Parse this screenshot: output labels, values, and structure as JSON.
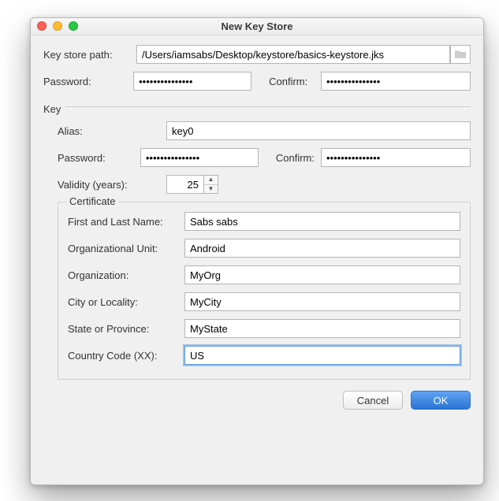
{
  "title": "New Key Store",
  "top": {
    "path_label": "Key store path:",
    "path_value": "/Users/iamsabs/Desktop/keystore/basics-keystore.jks",
    "password_label": "Password:",
    "password_value": "•••••••••••••••",
    "confirm_label": "Confirm:",
    "confirm_value": "•••••••••••••••"
  },
  "key": {
    "group_label": "Key",
    "alias_label": "Alias:",
    "alias_value": "key0",
    "password_label": "Password:",
    "password_value": "•••••••••••••••",
    "confirm_label": "Confirm:",
    "confirm_value": "•••••••••••••••",
    "validity_label": "Validity (years):",
    "validity_value": "25"
  },
  "cert": {
    "group_label": "Certificate",
    "first_last_label": "First and Last Name:",
    "first_last_value": "Sabs sabs",
    "org_unit_label": "Organizational Unit:",
    "org_unit_value": "Android",
    "org_label": "Organization:",
    "org_value": "MyOrg",
    "city_label": "City or Locality:",
    "city_value": "MyCity",
    "state_label": "State or Province:",
    "state_value": "MyState",
    "country_label": "Country Code (XX):",
    "country_value": "US"
  },
  "buttons": {
    "cancel": "Cancel",
    "ok": "OK"
  }
}
